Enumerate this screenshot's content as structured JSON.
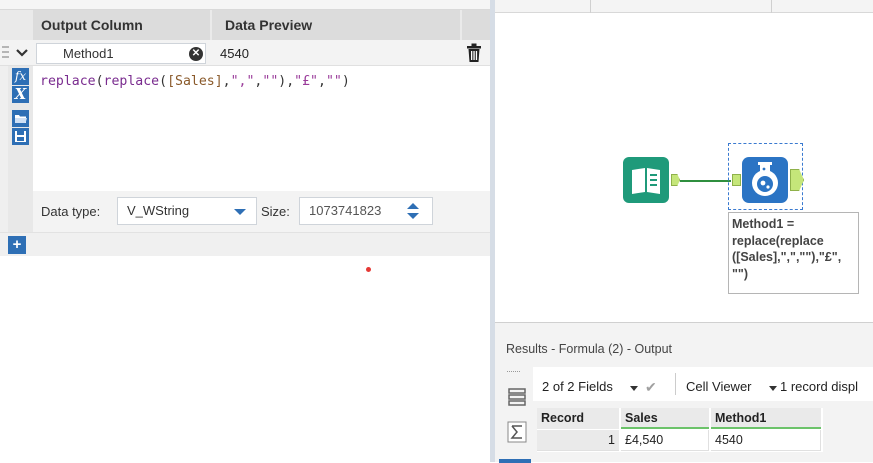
{
  "formula_panel": {
    "header": {
      "output_column": "Output Column",
      "data_preview": "Data Preview"
    },
    "row": {
      "column_name": "Method1",
      "preview": "4540"
    },
    "expression": {
      "parts": {
        "fn1": "replace",
        "p1": "(",
        "fn2": "replace",
        "p2": "(",
        "field": "[Sales]",
        "p3": ",",
        "s1": "\",\"",
        "p4": ",",
        "s2": "\"\"",
        "p5": "),",
        "s3": "\"£\"",
        "p6": ",",
        "s4": "\"\"",
        "p7": ")"
      }
    },
    "data_type_label": "Data type:",
    "data_type_value": "V_WString",
    "size_label": "Size:",
    "size_value": "1073741823"
  },
  "canvas": {
    "annotation": "Method1 =\nreplace(replace\n([Sales],\",\",\"\"),\"£\",\n\"\")"
  },
  "results": {
    "title": "Results - Formula (2) - Output",
    "fields_dropdown": "2 of 2 Fields",
    "cell_viewer": "Cell Viewer",
    "record_display": "1 record displ",
    "columns": [
      "Record",
      "Sales",
      "Method1"
    ],
    "rows": [
      {
        "record": "1",
        "sales": "£4,540",
        "method1": "4540"
      }
    ]
  },
  "colors": {
    "accent": "#2e6fb5",
    "input_tool": "#1f9a7a",
    "connector": "#2f8f3f",
    "anchor": "#c5e67a"
  },
  "icons": [
    "chevron-down-icon",
    "clear-icon",
    "trash-icon",
    "fx-icon",
    "variable-icon",
    "open-icon",
    "save-icon",
    "add-icon",
    "book-icon",
    "flask-icon",
    "fields-icon",
    "sum-icon",
    "checkmark-icon"
  ]
}
